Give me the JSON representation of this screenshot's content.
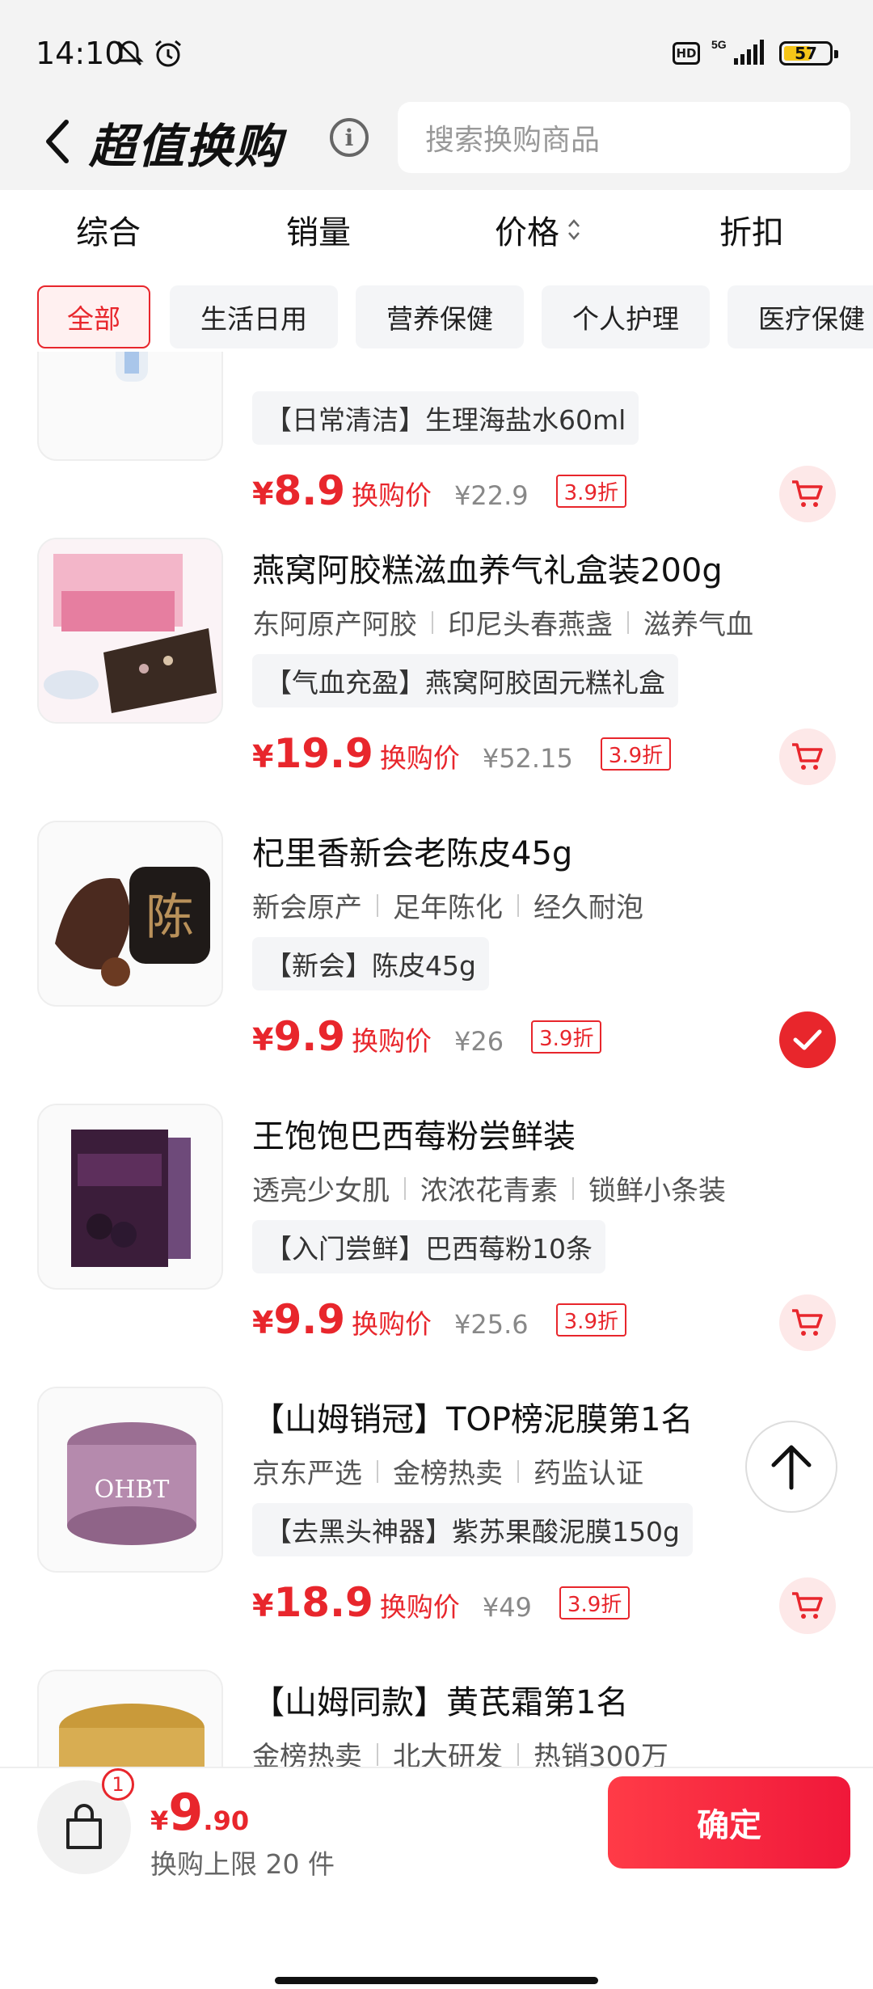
{
  "status_bar": {
    "time": "14:10",
    "hd": "HD",
    "network": "5G",
    "battery": "57"
  },
  "header": {
    "title": "超值换购",
    "search_placeholder": "搜索换购商品"
  },
  "sort_tabs": [
    "综合",
    "销量",
    "价格",
    "折扣"
  ],
  "categories": [
    "全部",
    "生活日用",
    "营养保健",
    "个人护理",
    "医疗保健"
  ],
  "products": [
    {
      "name": "",
      "tags": [],
      "promo": "【日常清洁】生理海盐水60ml",
      "price": "8.9",
      "price_label": "换购价",
      "original_price": "¥22.9",
      "discount": "3.9折",
      "selected": false
    },
    {
      "name": "燕窝阿胶糕滋血养气礼盒装200g",
      "tags": [
        "东阿原产阿胶",
        "印尼头春燕盏",
        "滋养气血"
      ],
      "promo": "【气血充盈】燕窝阿胶固元糕礼盒",
      "price": "19.9",
      "price_label": "换购价",
      "original_price": "¥52.15",
      "discount": "3.9折",
      "selected": false
    },
    {
      "name": "杞里香新会老陈皮45g",
      "tags": [
        "新会原产",
        "足年陈化",
        "经久耐泡"
      ],
      "promo": "【新会】陈皮45g",
      "price": "9.9",
      "price_label": "换购价",
      "original_price": "¥26",
      "discount": "3.9折",
      "selected": true
    },
    {
      "name": "王饱饱巴西莓粉尝鲜装",
      "tags": [
        "透亮少女肌",
        "浓浓花青素",
        "锁鲜小条装"
      ],
      "promo": "【入门尝鲜】巴西莓粉10条",
      "price": "9.9",
      "price_label": "换购价",
      "original_price": "¥25.6",
      "discount": "3.9折",
      "selected": false
    },
    {
      "name": "【山姆销冠】TOP榜泥膜第1名",
      "tags": [
        "京东严选",
        "金榜热卖",
        "药监认证"
      ],
      "promo": "【去黑头神器】紫苏果酸泥膜150g",
      "price": "18.9",
      "price_label": "换购价",
      "original_price": "¥49",
      "discount": "3.9折",
      "selected": false
    },
    {
      "name": "【山姆同款】黄芪霜第1名",
      "tags": [
        "金榜热卖",
        "北大研发",
        "热销300万"
      ],
      "promo": "",
      "price": "",
      "price_label": "",
      "original_price": "",
      "discount": "",
      "selected": false
    }
  ],
  "bottom": {
    "cart_count": "1",
    "currency": "¥",
    "total_int": "9",
    "total_dec": ".90",
    "limit_text": "换购上限 20 件",
    "confirm_label": "确定"
  },
  "colors": {
    "accent": "#e8262c",
    "chip_bg": "#f4f5f7",
    "header_bg": "#f3f3f3"
  }
}
